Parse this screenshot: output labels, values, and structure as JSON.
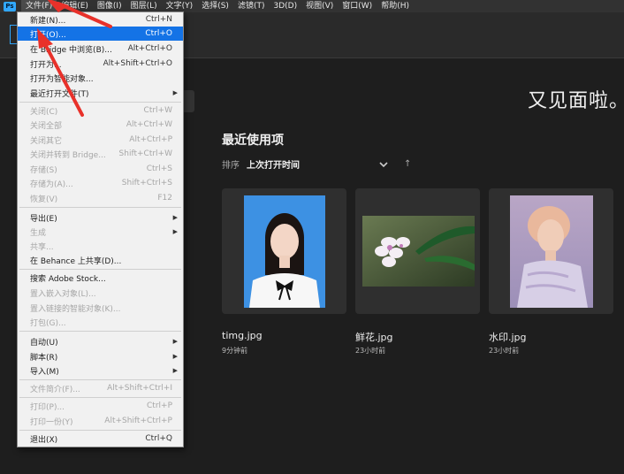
{
  "menubar": {
    "items": [
      "文件(F)",
      "编辑(E)",
      "图像(I)",
      "图层(L)",
      "文字(Y)",
      "选择(S)",
      "滤镜(T)",
      "3D(D)",
      "视图(V)",
      "窗口(W)",
      "帮助(H)"
    ]
  },
  "home": {
    "welcome": "又见面啦。",
    "recent_title": "最近使用项",
    "sort_label": "排序",
    "sort_value": "上次打开时间",
    "sort_dir_icon": "↑"
  },
  "files": [
    {
      "name": "timg.jpg",
      "time": "9分钟前"
    },
    {
      "name": "鲜花.jpg",
      "time": "23小时前"
    },
    {
      "name": "水印.jpg",
      "time": "23小时前"
    }
  ],
  "file_menu": {
    "items": [
      {
        "label": "新建(N)...",
        "shortcut": "Ctrl+N",
        "disabled": false
      },
      {
        "label": "打开(O)...",
        "shortcut": "Ctrl+O",
        "disabled": false,
        "highlight": true
      },
      {
        "label": "在 Bridge 中浏览(B)...",
        "shortcut": "Alt+Ctrl+O",
        "disabled": false
      },
      {
        "label": "打开为...",
        "shortcut": "Alt+Shift+Ctrl+O",
        "disabled": false
      },
      {
        "label": "打开为智能对象...",
        "shortcut": "",
        "disabled": false
      },
      {
        "label": "最近打开文件(T)",
        "shortcut": "",
        "disabled": false,
        "submenu": true
      },
      {
        "label": "关闭(C)",
        "shortcut": "Ctrl+W",
        "disabled": true
      },
      {
        "label": "关闭全部",
        "shortcut": "Alt+Ctrl+W",
        "disabled": true
      },
      {
        "label": "关闭其它",
        "shortcut": "Alt+Ctrl+P",
        "disabled": true
      },
      {
        "label": "关闭并转到 Bridge...",
        "shortcut": "Shift+Ctrl+W",
        "disabled": true
      },
      {
        "label": "存储(S)",
        "shortcut": "Ctrl+S",
        "disabled": true
      },
      {
        "label": "存储为(A)...",
        "shortcut": "Shift+Ctrl+S",
        "disabled": true
      },
      {
        "label": "恢复(V)",
        "shortcut": "F12",
        "disabled": true
      },
      {
        "label": "导出(E)",
        "shortcut": "",
        "disabled": false,
        "submenu": true
      },
      {
        "label": "生成",
        "shortcut": "",
        "disabled": true,
        "submenu": true
      },
      {
        "label": "共享...",
        "shortcut": "",
        "disabled": true
      },
      {
        "label": "在 Behance 上共享(D)...",
        "shortcut": "",
        "disabled": false
      },
      {
        "label": "搜索 Adobe Stock...",
        "shortcut": "",
        "disabled": false
      },
      {
        "label": "置入嵌入对象(L)...",
        "shortcut": "",
        "disabled": true
      },
      {
        "label": "置入链接的智能对象(K)...",
        "shortcut": "",
        "disabled": true
      },
      {
        "label": "打包(G)...",
        "shortcut": "",
        "disabled": true
      },
      {
        "label": "自动(U)",
        "shortcut": "",
        "disabled": false,
        "submenu": true
      },
      {
        "label": "脚本(R)",
        "shortcut": "",
        "disabled": false,
        "submenu": true
      },
      {
        "label": "导入(M)",
        "shortcut": "",
        "disabled": false,
        "submenu": true
      },
      {
        "label": "文件简介(F)...",
        "shortcut": "Alt+Shift+Ctrl+I",
        "disabled": true
      },
      {
        "label": "打印(P)...",
        "shortcut": "Ctrl+P",
        "disabled": true
      },
      {
        "label": "打印一份(Y)",
        "shortcut": "Alt+Shift+Ctrl+P",
        "disabled": true
      },
      {
        "label": "退出(X)",
        "shortcut": "Ctrl+Q",
        "disabled": false
      }
    ]
  },
  "colors": {
    "accent": "#1473e6",
    "annotation_arrow": "#e8312a",
    "ps_blue": "#31a8ff"
  }
}
